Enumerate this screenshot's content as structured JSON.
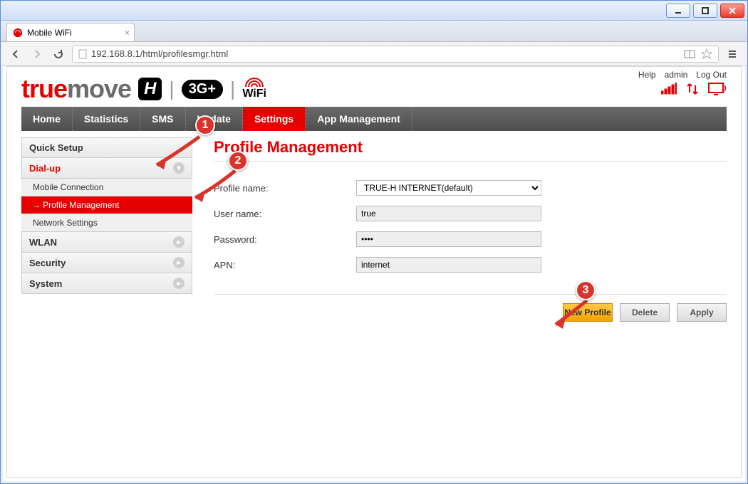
{
  "browser": {
    "tab_title": "Mobile WiFi",
    "url": "192.168.8.1/html/profilesmgr.html"
  },
  "header": {
    "links": {
      "help": "Help",
      "admin": "admin",
      "logout": "Log Out"
    },
    "logo": {
      "true": "true",
      "move": "move",
      "h": "H",
      "threeG": "3G+",
      "wifi": "WiFi"
    }
  },
  "nav": {
    "home": "Home",
    "statistics": "Statistics",
    "sms": "SMS",
    "update": "Update",
    "settings": "Settings",
    "appmgmt": "App Management"
  },
  "side": {
    "quick_setup": "Quick Setup",
    "dialup": "Dial-up",
    "dialup_items": {
      "mobile_connection": "Mobile Connection",
      "profile_management": "Profile Management",
      "network_settings": "Network Settings"
    },
    "wlan": "WLAN",
    "security": "Security",
    "system": "System"
  },
  "content": {
    "title": "Profile Management",
    "labels": {
      "profile_name": "Profile name:",
      "user_name": "User name:",
      "password": "Password:",
      "apn": "APN:"
    },
    "values": {
      "profile_name": "TRUE-H INTERNET(default)",
      "user_name": "true",
      "password": "••••",
      "apn": "internet"
    },
    "buttons": {
      "new_profile": "New Profile",
      "delete": "Delete",
      "apply": "Apply"
    }
  },
  "annotations": {
    "one": "1",
    "two": "2",
    "three": "3"
  }
}
